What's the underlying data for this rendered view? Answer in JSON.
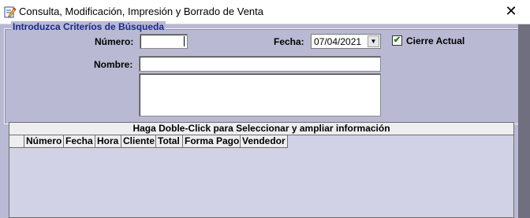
{
  "window": {
    "title": "Consulta, Modificación, Impresión y Borrado de Venta",
    "close_symbol": "✕",
    "icon": "edit-document-icon"
  },
  "search": {
    "group_title": "Introduzca Criteríos de Búsqueda",
    "numero_label": "Número:",
    "numero_value": "",
    "fecha_label": "Fecha:",
    "fecha_value": "07/04/2021",
    "cierre_label": "Cierre Actual",
    "cierre_checked": true,
    "nombre_label": "Nombre:",
    "nombre_value": "",
    "notes_value": ""
  },
  "grid": {
    "caption": "Haga Doble-Click para Seleccionar y ampliar información",
    "columns": [
      "Número",
      "Fecha",
      "Hora",
      "Cliente",
      "Total",
      "Forma Pago",
      "Vendedor"
    ],
    "rows": []
  }
}
